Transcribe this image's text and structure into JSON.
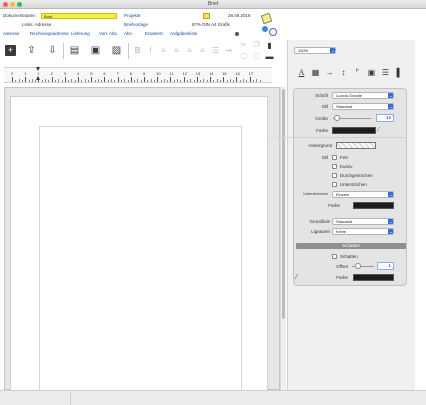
{
  "window": {
    "title": "Brief"
  },
  "info": {
    "document_label": "Dokumentname:",
    "document_value": "Brief",
    "projects_link": "Projekte",
    "date": "28.06.2016",
    "row2_left": "Links: Adresse",
    "row2_mid": "Briefvorlage",
    "row2_right": "87% DIN A4 Grafik",
    "links": [
      "Adresse",
      "Rechnungsadresse",
      "Lieferung",
      "Vorl. Abs.",
      "Abs.",
      "Erweitert",
      "Aufgabenliste"
    ]
  },
  "toolbar": {
    "icons": [
      "plus-icon",
      "export-icon",
      "import-icon",
      "print-icon",
      "print-preview-icon",
      "pdf-icon"
    ],
    "format_icons": [
      "bold-icon",
      "italic-icon",
      "align-left-icon",
      "align-center-icon",
      "align-right-icon",
      "justify-icon",
      "list-icon",
      "indent-icon"
    ]
  },
  "ruler": {
    "numbers": [
      "2",
      "1",
      "1",
      "2",
      "3",
      "4",
      "5",
      "6",
      "7",
      "8",
      "9",
      "10",
      "11",
      "12",
      "13",
      "14",
      "15",
      "16",
      "17"
    ]
  },
  "zoom": {
    "value": "100%"
  },
  "inspector": {
    "tabs": [
      "text-format-icon",
      "paragraph-icon",
      "arrow-icon",
      "spacing-icon",
      "corner-icon",
      "frame-icon",
      "layers-icon",
      "pin-icon"
    ],
    "font_label": "Schrift",
    "font_value": "Lucida Grande",
    "style_label": "Stil",
    "style_value": "Standard",
    "size_label": "Größe",
    "size_value": "12",
    "color_label": "Farbe",
    "background_label": "Hintergrund",
    "stil_label": "Stil",
    "options": [
      "Fett",
      "Kursiv",
      "Durchgestrichen",
      "Unterstrichen"
    ],
    "underline_label": "Unterstreichen",
    "underline_value": "Einzeln",
    "underline_color_label": "Farbe",
    "baseline_label": "Grundlinie",
    "baseline_value": "Standard",
    "ligature_label": "Ligaturen",
    "ligature_value": "Keine",
    "shadow_header": "Schatten",
    "shadow_checkbox": "Schatten",
    "shadow_offset_label": "Offset",
    "shadow_offset_value": "1",
    "shadow_color_label": "Farbe"
  },
  "colors": {
    "accent": "#2f6de0",
    "yellow": "#f5ef4a",
    "inspector_bg": "#e4e4e4"
  }
}
